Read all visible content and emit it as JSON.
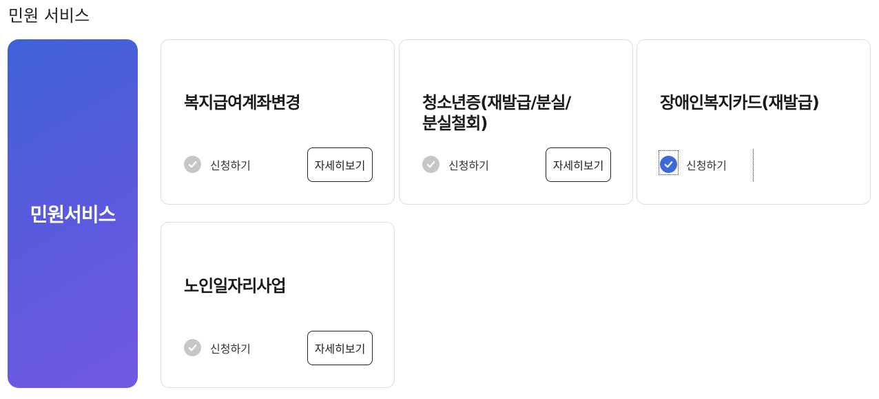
{
  "page": {
    "heading": "민원 서비스"
  },
  "hero": {
    "label": "민원서비스"
  },
  "cards": [
    {
      "title": "복지급여계좌변경",
      "apply_label": "신청하기",
      "detail_label": "자세히보기",
      "checked": false
    },
    {
      "title_lines": [
        "청소년증(재발급/분실/",
        "분실철회)"
      ],
      "apply_label": "신청하기",
      "detail_label": "자세히보기",
      "checked": false
    },
    {
      "title": "장애인복지카드(재발급)",
      "apply_label": "신청하기",
      "checked": true
    },
    {
      "title": "노인일자리사업",
      "apply_label": "신청하기",
      "detail_label": "자세히보기",
      "checked": false
    }
  ],
  "colors": {
    "accent": "#3d68d8",
    "hero_start": "#3f62d8",
    "hero_end": "#7259e4",
    "check_inactive": "#c7c7c7"
  },
  "icons": {
    "check": "check-circle-icon"
  }
}
